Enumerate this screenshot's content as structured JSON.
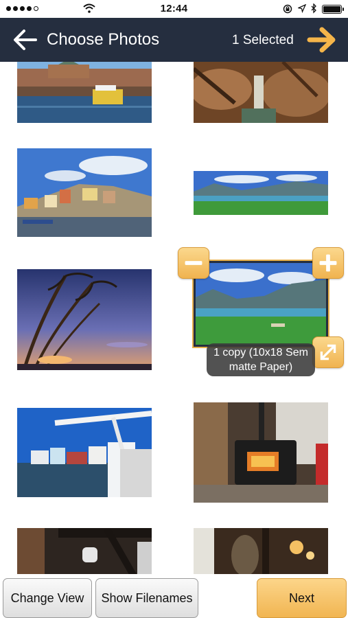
{
  "status_bar": {
    "time": "12:44",
    "icons": [
      "signal-dots-icon",
      "wifi-icon",
      "rotation-lock-icon",
      "location-icon",
      "bluetooth-icon",
      "battery-icon"
    ]
  },
  "header": {
    "title": "Choose Photos",
    "selected_text": "1 Selected",
    "back_icon": "back-arrow-icon",
    "forward_icon": "next-arrow-icon",
    "background": "#252e3f",
    "accent": "#f5b54a"
  },
  "photos": [
    {
      "id": "photo-1",
      "subject": "harbor-city"
    },
    {
      "id": "photo-2",
      "subject": "canyon-waterfall"
    },
    {
      "id": "photo-3",
      "subject": "hillside-village"
    },
    {
      "id": "photo-4",
      "subject": "valley-lake"
    },
    {
      "id": "photo-5",
      "subject": "palm-sunset"
    },
    {
      "id": "photo-6",
      "subject": "mountain-lake",
      "selected": true
    },
    {
      "id": "photo-7",
      "subject": "seaside-houses"
    },
    {
      "id": "photo-8",
      "subject": "wood-stove"
    },
    {
      "id": "photo-9",
      "subject": "interior"
    },
    {
      "id": "photo-10",
      "subject": "interior-lamps"
    }
  ],
  "selection_controls": {
    "icons": [
      "minus-icon",
      "plus-icon",
      "expand-icon"
    ],
    "caption_line1": "1 copy (10x18 Sem",
    "caption_line2": "matte Paper)"
  },
  "bottom_bar": {
    "change_view": "Change View",
    "show_filenames": "Show Filenames",
    "next": "Next"
  }
}
